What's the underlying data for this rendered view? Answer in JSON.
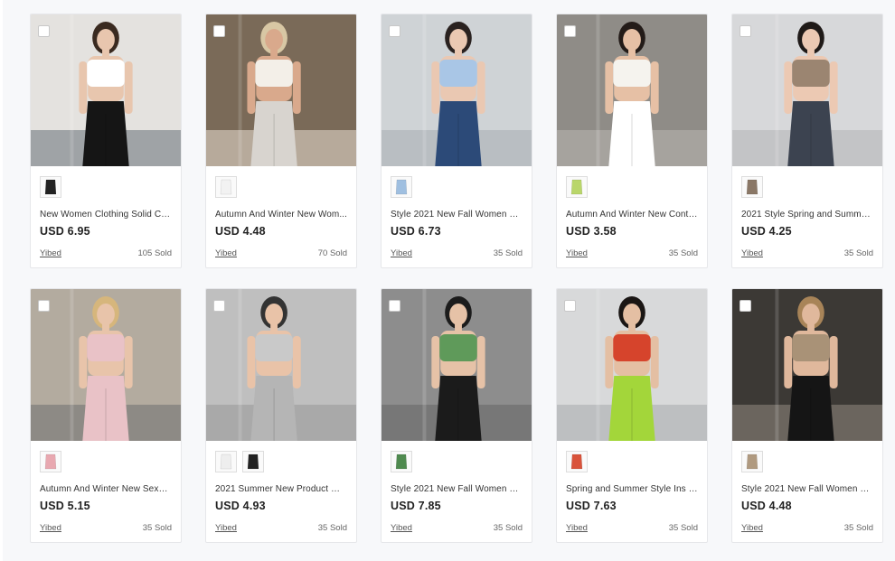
{
  "products": [
    {
      "title": "New Women Clothing Solid Col...",
      "price": "USD 6.95",
      "seller": "Yibed",
      "sold": "105 Sold",
      "thumbs": [
        "#222"
      ],
      "image": {
        "bg": "#e4e2df",
        "floor": "#9fa3a6",
        "top": "#ffffff",
        "bottom": "#151515",
        "skin": "#e8c6ae",
        "hair": "#3a2a20"
      }
    },
    {
      "title": "Autumn And Winter New Wom...",
      "price": "USD 4.48",
      "seller": "Yibed",
      "sold": "70 Sold",
      "thumbs": [
        "#f2f2f2"
      ],
      "image": {
        "bg": "#7a6a58",
        "floor": "#b7aa9b",
        "top": "#f3efe8",
        "bottom": "#d8d4cf",
        "skin": "#d9a98c",
        "hair": "#d8c7a4"
      }
    },
    {
      "title": "Style 2021 New Fall Women Clo...",
      "price": "USD 6.73",
      "seller": "Yibed",
      "sold": "35 Sold",
      "thumbs": [
        "#9fbfe0"
      ],
      "image": {
        "bg": "#cfd3d6",
        "floor": "#b9bec2",
        "top": "#a9c6e6",
        "bottom": "#2c4a78",
        "skin": "#eac8b2",
        "hair": "#2a2220"
      }
    },
    {
      "title": "Autumn And Winter New Contr...",
      "price": "USD 3.58",
      "seller": "Yibed",
      "sold": "35 Sold",
      "thumbs": [
        "#b9d66a"
      ],
      "image": {
        "bg": "#8f8c87",
        "floor": "#a6a39e",
        "top": "#f5f3ee",
        "bottom": "#ffffff",
        "skin": "#e6c0a5",
        "hair": "#231b18"
      }
    },
    {
      "title": "2021 Style Spring and Summer ...",
      "price": "USD 4.25",
      "seller": "Yibed",
      "sold": "35 Sold",
      "thumbs": [
        "#8a7766"
      ],
      "image": {
        "bg": "#d7d8da",
        "floor": "#c3c4c6",
        "top": "#9b8571",
        "bottom": "#3c4350",
        "skin": "#ecc9b3",
        "hair": "#1f1a18"
      }
    },
    {
      "title": "Autumn And Winter New Sexy ...",
      "price": "USD 5.15",
      "seller": "Yibed",
      "sold": "35 Sold",
      "thumbs": [
        "#e8a8b0"
      ],
      "image": {
        "bg": "#b3ab9f",
        "floor": "#8d8a85",
        "top": "#e9c2c7",
        "bottom": "#e9c2c7",
        "skin": "#e8c4aa",
        "hair": "#d6b67c"
      }
    },
    {
      "title": "2021 Summer New Product Wo...",
      "price": "USD 4.93",
      "seller": "Yibed",
      "sold": "35 Sold",
      "thumbs": [
        "#eeeeee",
        "#222222"
      ],
      "image": {
        "bg": "#bfbfbf",
        "floor": "#a9a9a9",
        "top": "#c9c9c9",
        "bottom": "#b5b5b5",
        "skin": "#e9c3a8",
        "hair": "#333"
      }
    },
    {
      "title": "Style 2021 New Fall Women Clo...",
      "price": "USD 7.85",
      "seller": "Yibed",
      "sold": "35 Sold",
      "thumbs": [
        "#4f8a4f"
      ],
      "image": {
        "bg": "#8d8d8d",
        "floor": "#777",
        "top": "#5f9a5a",
        "bottom": "#1b1b1b",
        "skin": "#e6c2a7",
        "hair": "#1c1c1c"
      }
    },
    {
      "title": "Spring and Summer Style Ins N...",
      "price": "USD 7.63",
      "seller": "Yibed",
      "sold": "35 Sold",
      "thumbs": [
        "#d9533b"
      ],
      "image": {
        "bg": "#d8d9da",
        "floor": "#bdbfc1",
        "top": "#d6442c",
        "bottom": "#a3d63a",
        "skin": "#e4bfa3",
        "hair": "#1a1614"
      }
    },
    {
      "title": "Style 2021 New Fall Women Clo...",
      "price": "USD 4.48",
      "seller": "Yibed",
      "sold": "35 Sold",
      "thumbs": [
        "#b09a80"
      ],
      "image": {
        "bg": "#3c3935",
        "floor": "#6b655e",
        "top": "#a99277",
        "bottom": "#151515",
        "skin": "#e0b89c",
        "hair": "#a88458"
      }
    }
  ]
}
